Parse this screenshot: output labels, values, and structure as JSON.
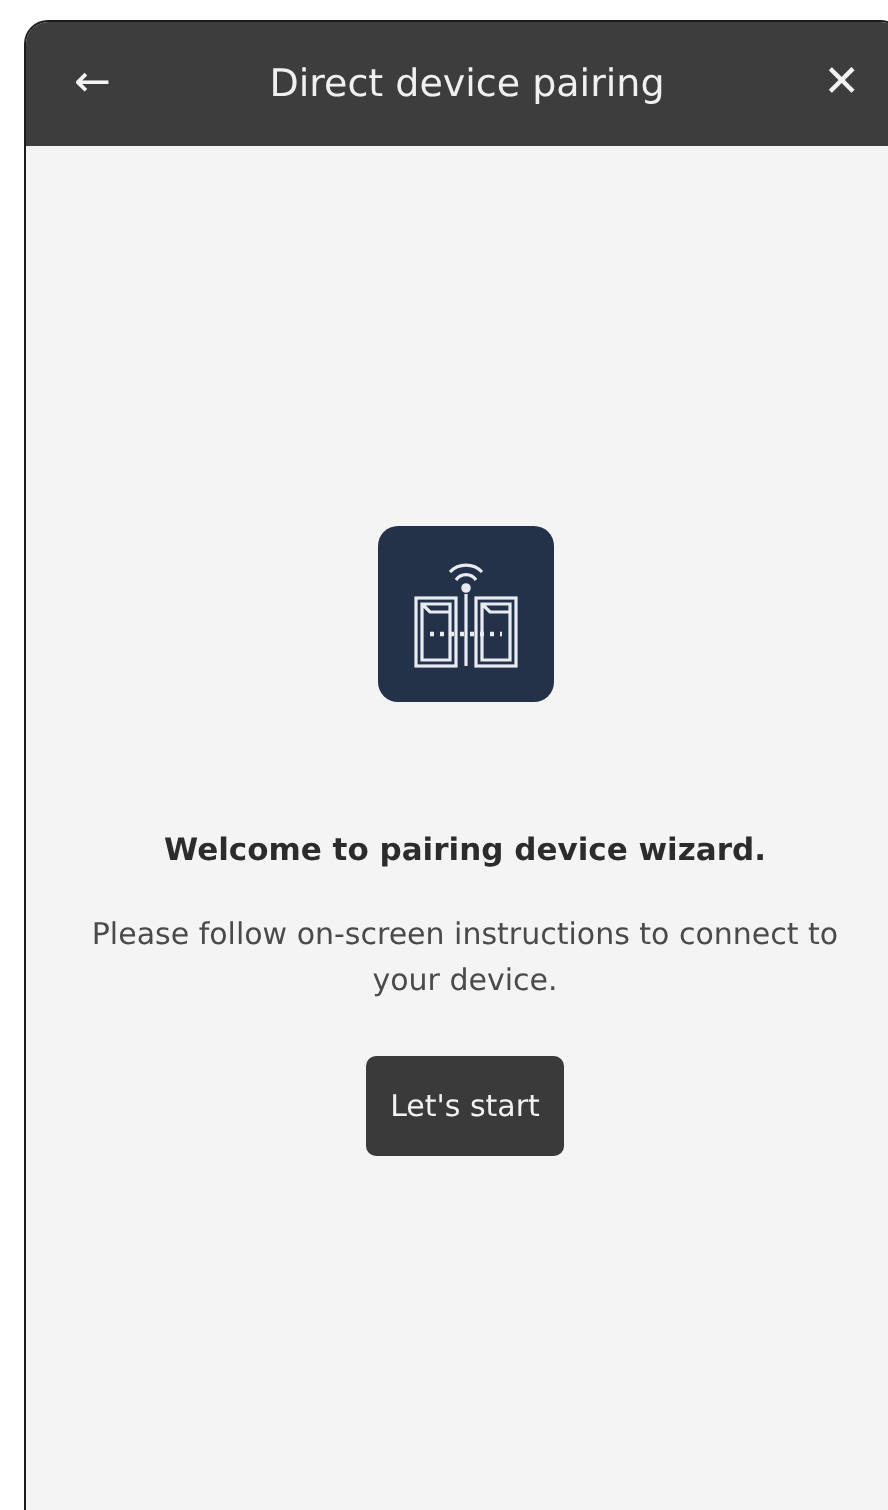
{
  "header": {
    "back": "←",
    "title": "Direct device pairing",
    "close": "✕"
  },
  "content": {
    "heading": "Welcome to pairing device wizard.",
    "message": "Please follow on-screen instructions to connect to your device.",
    "button": "Let's start"
  }
}
